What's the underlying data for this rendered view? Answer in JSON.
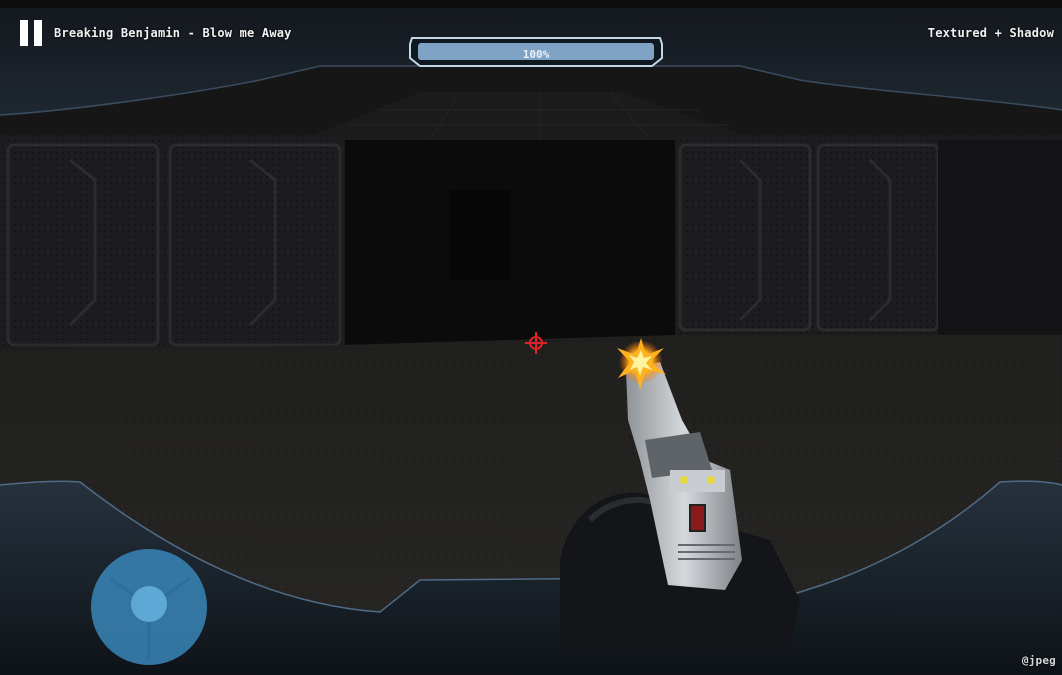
{
  "hud": {
    "track_title": "Breaking Benjamin - Blow me Away",
    "render_mode": "Textured + Shadow",
    "health": 1.0,
    "health_label": "100%",
    "credit": "@jpeg"
  },
  "colors": {
    "hud_frame": "#1b2733",
    "hud_edge": "#a9c4dc",
    "health_fill": "#7fa3c4",
    "crosshair": "#e0222a",
    "joystick": "#3a86b8",
    "joystick_knob": "#5ea8d6",
    "muzzle_flash": "#ffb21e"
  },
  "icons": {
    "pause": "pause-icon",
    "crosshair": "crosshair-icon",
    "joystick": "joystick-icon"
  }
}
